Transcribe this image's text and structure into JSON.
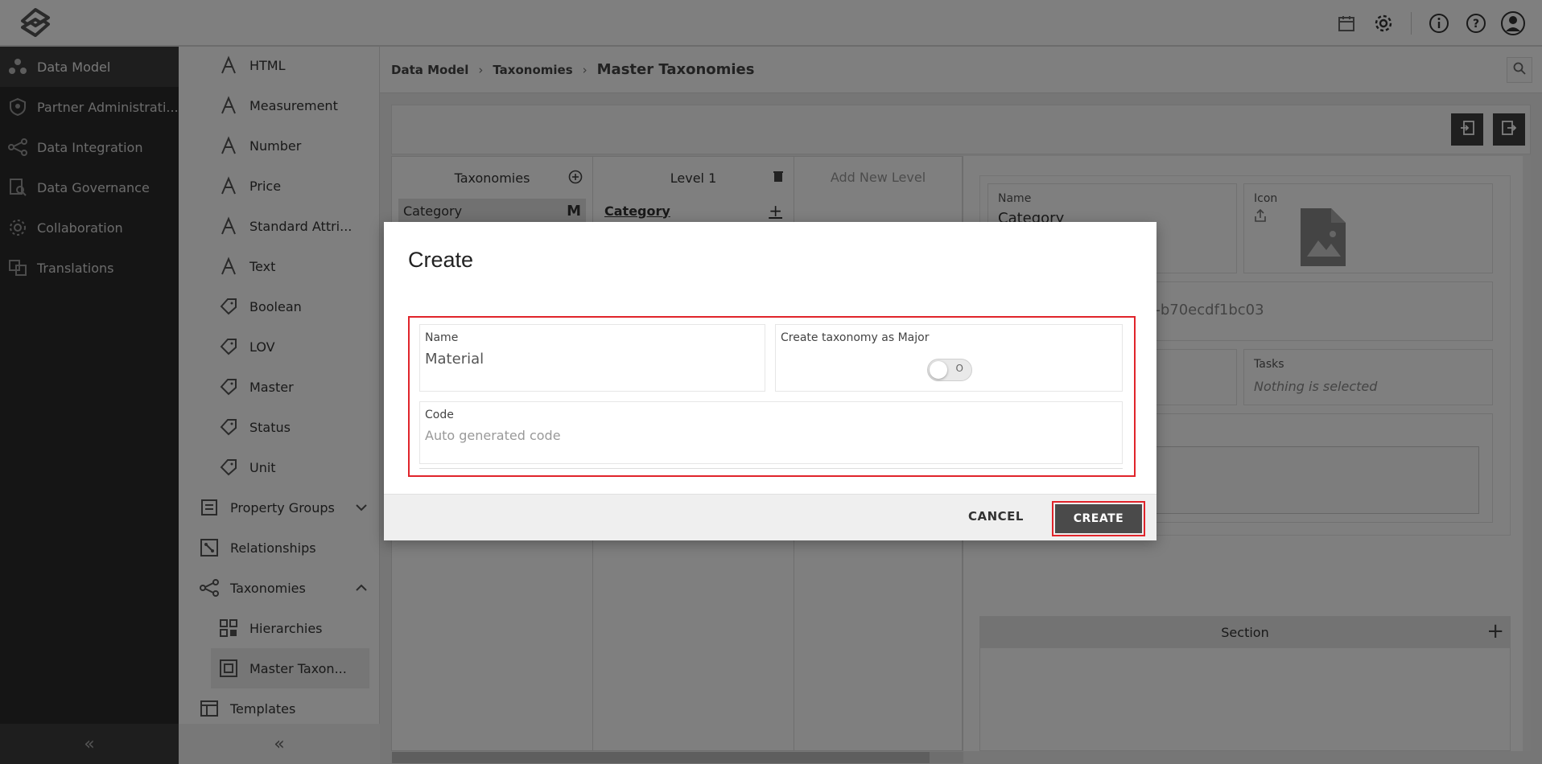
{
  "leftnav": {
    "items": [
      {
        "label": "Data Model",
        "icon": "data-model-icon"
      },
      {
        "label": "Partner Administrati...",
        "icon": "shield-icon"
      },
      {
        "label": "Data Integration",
        "icon": "integration-icon"
      },
      {
        "label": "Data Governance",
        "icon": "governance-icon"
      },
      {
        "label": "Collaboration",
        "icon": "collaboration-icon"
      },
      {
        "label": "Translations",
        "icon": "translations-icon"
      }
    ],
    "collapse": "«"
  },
  "subnav": {
    "items": [
      {
        "label": "HTML"
      },
      {
        "label": "Measurement"
      },
      {
        "label": "Number"
      },
      {
        "label": "Price"
      },
      {
        "label": "Standard Attri..."
      },
      {
        "label": "Text"
      },
      {
        "label": "Boolean"
      },
      {
        "label": "LOV"
      },
      {
        "label": "Master"
      },
      {
        "label": "Status"
      },
      {
        "label": "Unit"
      },
      {
        "label": "Property Groups"
      },
      {
        "label": "Relationships"
      },
      {
        "label": "Taxonomies"
      },
      {
        "label": "Hierarchies"
      },
      {
        "label": "Master Taxon..."
      },
      {
        "label": "Templates"
      }
    ],
    "collapse": "«"
  },
  "breadcrumb": {
    "items": [
      "Data Model",
      "Taxonomies"
    ],
    "current": "Master Taxonomies",
    "separator": "›"
  },
  "columns": {
    "taxonomies_header": "Taxonomies",
    "taxonomy_row": {
      "label": "Category",
      "badge": "M"
    },
    "level_header": "Level 1",
    "level_row": "Category",
    "add_level": "Add New Level"
  },
  "details": {
    "name_label": "Name",
    "name_value": "Category",
    "icon_label": "Icon",
    "id_fragment": "f-b70ecdf1bc03",
    "tasks_label": "Tasks",
    "tasks_value": "Nothing is selected",
    "section_label": "Section"
  },
  "dialog": {
    "title": "Create",
    "name_label": "Name",
    "name_value": "Material",
    "major_label": "Create taxonomy as Major",
    "toggle_text": "O",
    "code_label": "Code",
    "code_placeholder": "Auto generated code",
    "cancel_label": "CANCEL",
    "create_label": "CREATE"
  },
  "colors": {
    "highlight": "#e0242b",
    "nav_bg": "#2b2b2b",
    "button_dark": "#4a4a4a"
  }
}
